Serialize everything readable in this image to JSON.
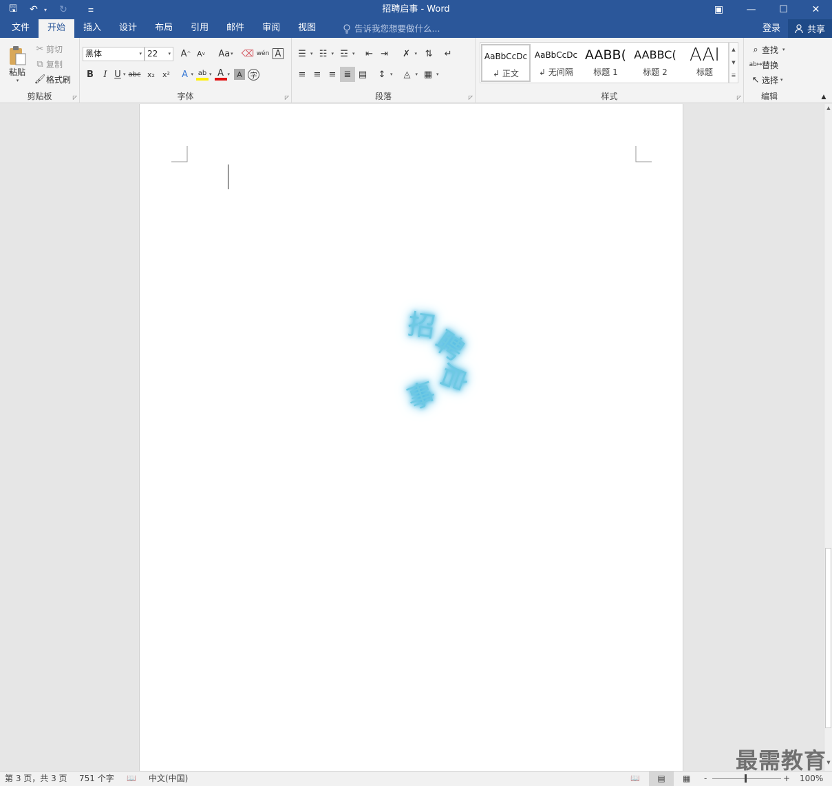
{
  "window": {
    "title": "招聘启事 - Word",
    "controls": {
      "ribbon_display": "▣",
      "minimize": "—",
      "maximize": "☐",
      "close": "✕"
    }
  },
  "qat": {
    "save": "🖫",
    "undo": "↶",
    "undo_dd": "▾",
    "redo": "↻",
    "customize": "≡"
  },
  "tabs": [
    {
      "label": "文件"
    },
    {
      "label": "开始"
    },
    {
      "label": "插入"
    },
    {
      "label": "设计"
    },
    {
      "label": "布局"
    },
    {
      "label": "引用"
    },
    {
      "label": "邮件"
    },
    {
      "label": "审阅"
    },
    {
      "label": "视图"
    }
  ],
  "tell_me": "告诉我您想要做什么...",
  "account": {
    "signin": "登录",
    "share": "共享"
  },
  "clipboard": {
    "label": "剪贴板",
    "paste": "粘贴",
    "cut": "剪切",
    "copy": "复制",
    "format_painter": "格式刷"
  },
  "font": {
    "label": "字体",
    "name": "黑体",
    "size": "22",
    "grow": "A",
    "shrink": "A",
    "case": "Aa",
    "phonetic": "wén",
    "border": "A",
    "bold": "B",
    "italic": "I",
    "underline": "U",
    "strike": "abc",
    "sub": "x₂",
    "sup": "x²",
    "effects": "A",
    "highlight": "ab",
    "color": "A",
    "shade": "A",
    "enclose": "字"
  },
  "paragraph": {
    "label": "段落"
  },
  "styles": {
    "label": "样式",
    "items": [
      {
        "preview": "AaBbCcDc",
        "name": "正文"
      },
      {
        "preview": "AaBbCcDc",
        "name": "无间隔"
      },
      {
        "preview": "AABB(",
        "name": "标题 1"
      },
      {
        "preview": "AABBC(",
        "name": "标题 2"
      },
      {
        "preview": "AAI",
        "name": "标题"
      }
    ]
  },
  "editing": {
    "label": "编辑",
    "find": "查找",
    "replace": "替换",
    "select": "选择"
  },
  "document": {
    "wordart": {
      "chars": [
        "招",
        "聘",
        "启",
        "事"
      ]
    }
  },
  "status": {
    "page": "第 3 页，共 3 页",
    "words": "751 个字",
    "language": "中文(中国)",
    "zoom": "100%",
    "zoom_minus": "-",
    "zoom_plus": "+"
  },
  "watermark": "最需教育",
  "colors": {
    "accent": "#2b579a",
    "wordart_glow": "#44b6e0"
  }
}
